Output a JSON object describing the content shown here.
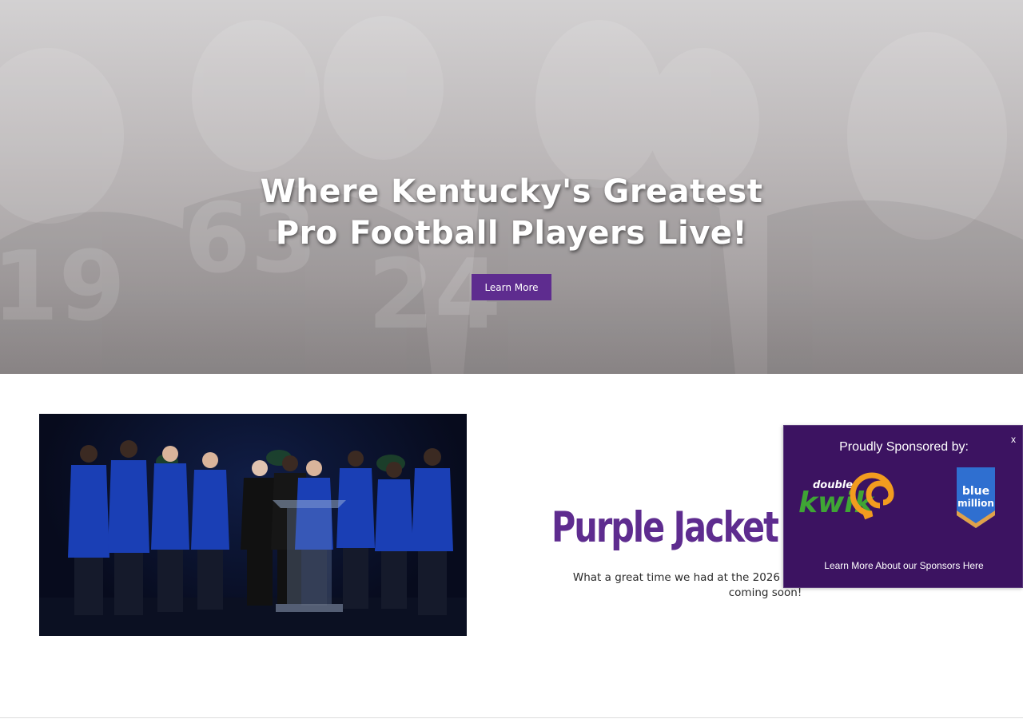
{
  "hero": {
    "title_line1": "Where Kentucky's Greatest",
    "title_line2": "Pro Football Players Live!",
    "button_label": "Learn More",
    "jersey_numbers": [
      "19",
      "63",
      "24"
    ]
  },
  "news": {
    "heading": "Purple Jacket",
    "body": "What a great time we had at the 2026 Induction Ceremony! Photos are coming soon!"
  },
  "sponsor_popup": {
    "title": "Proudly Sponsored by:",
    "close_label": "x",
    "link_text": "Learn More About our Sponsors Here",
    "logos": {
      "kwik_small": "double",
      "kwik_main": "kwik",
      "blue_million_line1": "blue",
      "blue_million_line2": "million"
    }
  },
  "colors": {
    "brand_purple": "#5e2c8f",
    "popup_bg": "#3c1361",
    "jacket_blue": "#1a3fb5"
  }
}
